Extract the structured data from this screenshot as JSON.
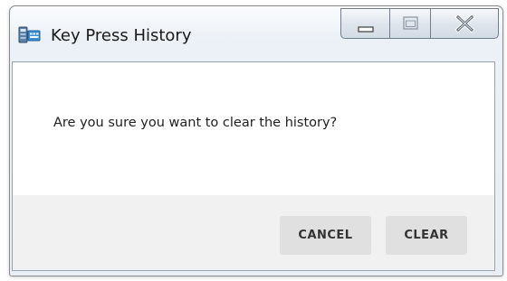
{
  "window": {
    "title": "Key Press History",
    "app_icon": "keyboard-app-icon",
    "controls": {
      "minimize_icon": "minimize-icon",
      "maximize_icon": "maximize-icon",
      "close_icon": "close-icon"
    }
  },
  "dialog": {
    "message": "Are you sure you want to clear the history?",
    "buttons": {
      "cancel_label": "CANCEL",
      "clear_label": "CLEAR"
    }
  },
  "colors": {
    "body_background": "#ffffff",
    "footer_background": "#f1f1f1",
    "button_background": "#e0e0e0",
    "button_text": "#333333"
  }
}
